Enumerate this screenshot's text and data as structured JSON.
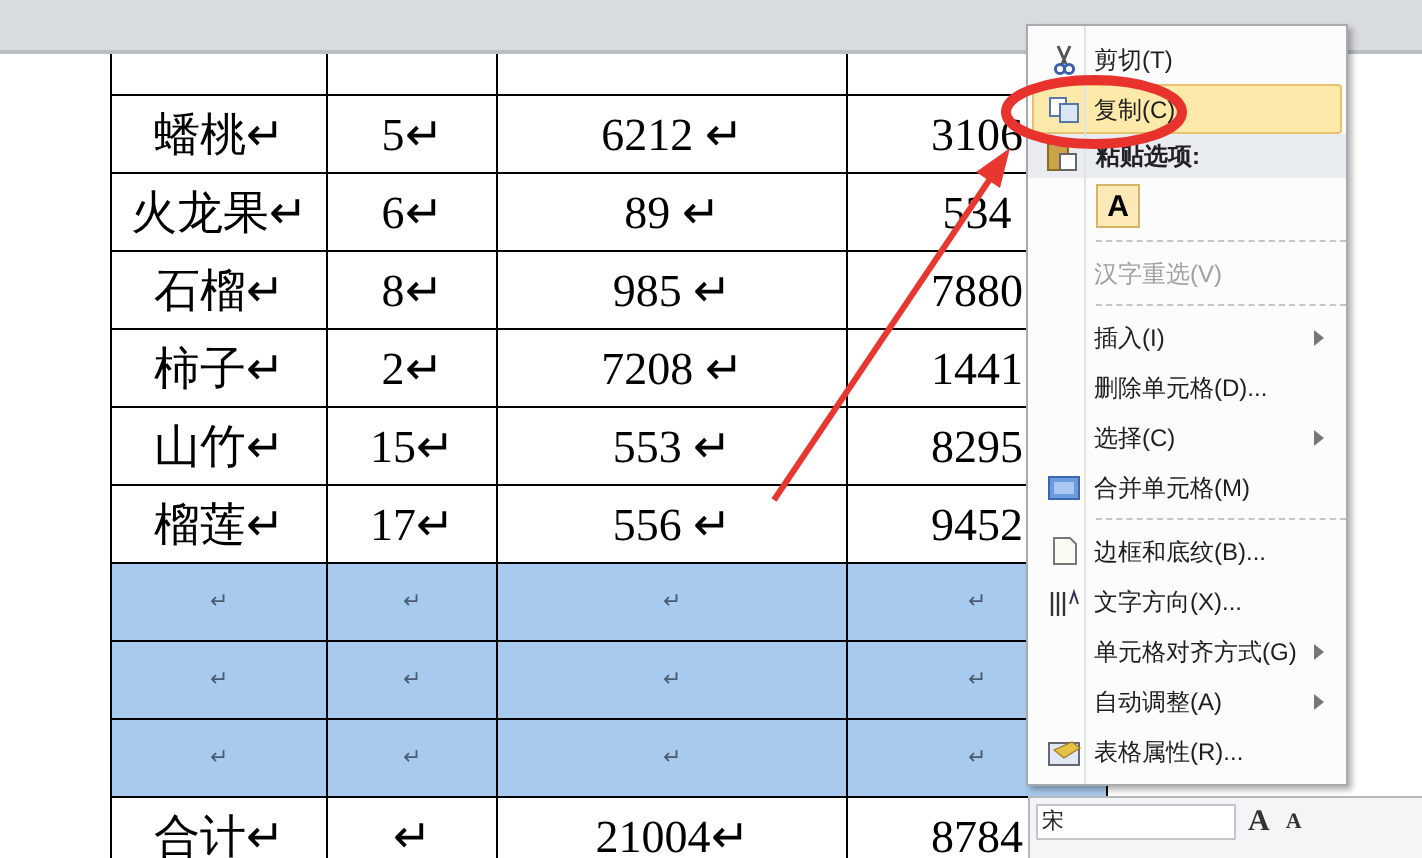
{
  "table": {
    "rows": [
      {
        "cells": [
          "蟠桃↵",
          "5↵",
          "6212 ↵",
          "3106"
        ],
        "selected": false
      },
      {
        "cells": [
          "火龙果↵",
          "6↵",
          "89 ↵",
          "534"
        ],
        "selected": false
      },
      {
        "cells": [
          "石榴↵",
          "8↵",
          "985 ↵",
          "7880"
        ],
        "selected": false
      },
      {
        "cells": [
          "柿子↵",
          "2↵",
          "7208 ↵",
          "1441"
        ],
        "selected": false
      },
      {
        "cells": [
          "山竹↵",
          "15↵",
          "553 ↵",
          "8295"
        ],
        "selected": false
      },
      {
        "cells": [
          "榴莲↵",
          "17↵",
          "556 ↵",
          "9452"
        ],
        "selected": false
      },
      {
        "cells": [
          "↵",
          "↵",
          "↵",
          "↵"
        ],
        "selected": true
      },
      {
        "cells": [
          "↵",
          "↵",
          "↵",
          "↵"
        ],
        "selected": true
      },
      {
        "cells": [
          "↵",
          "↵",
          "↵",
          "↵"
        ],
        "selected": true
      },
      {
        "cells": [
          "合计↵",
          "↵",
          "21004↵",
          "8784"
        ],
        "selected": false
      }
    ]
  },
  "context_menu": {
    "items": [
      {
        "kind": "item",
        "label": "剪切(T)",
        "selected": false,
        "disabled": false,
        "submenu": false
      },
      {
        "kind": "item",
        "label": "复制(C)",
        "selected": true,
        "disabled": false,
        "submenu": false
      },
      {
        "kind": "header",
        "label": "粘贴选项:"
      },
      {
        "kind": "paste_options",
        "label": "A"
      },
      {
        "kind": "separator"
      },
      {
        "kind": "item",
        "label": "汉字重选(V)",
        "selected": false,
        "disabled": true,
        "submenu": false
      },
      {
        "kind": "separator"
      },
      {
        "kind": "item",
        "label": "插入(I)",
        "selected": false,
        "disabled": false,
        "submenu": true
      },
      {
        "kind": "item",
        "label": "删除单元格(D)...",
        "selected": false,
        "disabled": false,
        "submenu": false
      },
      {
        "kind": "item",
        "label": "选择(C)",
        "selected": false,
        "disabled": false,
        "submenu": true
      },
      {
        "kind": "item",
        "label": "合并单元格(M)",
        "selected": false,
        "disabled": false,
        "submenu": false
      },
      {
        "kind": "separator"
      },
      {
        "kind": "item",
        "label": "边框和底纹(B)...",
        "selected": false,
        "disabled": false,
        "submenu": false
      },
      {
        "kind": "item",
        "label": "文字方向(X)...",
        "selected": false,
        "disabled": false,
        "submenu": false
      },
      {
        "kind": "item",
        "label": "单元格对齐方式(G)",
        "selected": false,
        "disabled": false,
        "submenu": true
      },
      {
        "kind": "item",
        "label": "自动调整(A)",
        "selected": false,
        "disabled": false,
        "submenu": true
      },
      {
        "kind": "item",
        "label": "表格属性(R)...",
        "selected": false,
        "disabled": false,
        "submenu": false
      }
    ]
  },
  "mini_toolbar": {
    "font": "宋",
    "buttons": [
      "A",
      "A"
    ]
  }
}
